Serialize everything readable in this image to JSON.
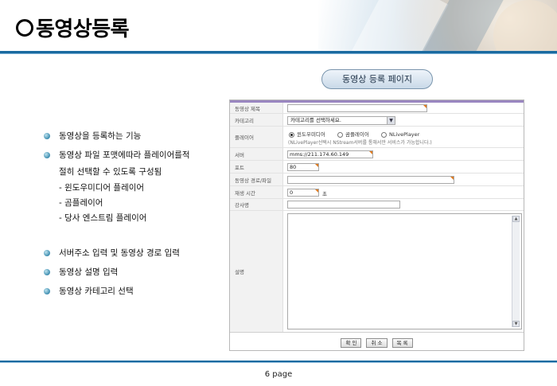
{
  "header": {
    "title": "동영상등록"
  },
  "callout": {
    "label": "동영상 등록 페이지"
  },
  "bullets": [
    "동영상을 등록하는 기능",
    "동영상 파일 포맷에따라 플레이어를적",
    "절히 선택할 수 있도록 구성됨",
    "- 윈도우미디어 플레이어",
    "- 곰플레이어",
    "- 당사 엔스트림 플레이어",
    "서버주소 입력 및 동영상 경로 입력",
    "동영상 설명 입력",
    "동영상 카테고리 선택"
  ],
  "form": {
    "labels": {
      "title": "동영상 제목",
      "category": "카테고리",
      "player": "플레이어",
      "server": "서버",
      "port": "포트",
      "path": "동영상 경로/파일",
      "duration": "재생 시간",
      "lecturer": "강사명",
      "description": "설명"
    },
    "category_selected": "카테고리를 선택하세요.",
    "player_options": [
      "윈도우미디어",
      "곰플레이어",
      "NLivePlayer"
    ],
    "player_selected": "윈도우미디어",
    "player_hint": "(NLivePlayer선택시 NStream서버를 통해서만 서비스가 가능합니다.)",
    "server_value": "mms://211.174.60.149",
    "port_value": "80",
    "duration_value": "0",
    "duration_unit": "초",
    "buttons": {
      "confirm": "확 인",
      "cancel": "취 소",
      "list": "목 록"
    }
  },
  "footer": {
    "page": "6 page"
  },
  "colors": {
    "accent": "#1a6aa0",
    "required_marker": "#e07a1e",
    "panel_top": "#9a86c0"
  }
}
